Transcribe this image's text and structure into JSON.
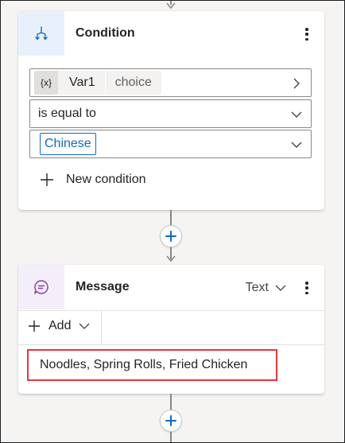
{
  "condition_card": {
    "title": "Condition",
    "icon": "branch-icon",
    "variable": {
      "badge": "{x}",
      "name": "Var1",
      "type": "choice"
    },
    "operator": "is equal to",
    "value": "Chinese",
    "new_condition_label": "New condition"
  },
  "message_card": {
    "title": "Message",
    "icon": "chat-bubble-icon",
    "type_label": "Text",
    "add_label": "Add",
    "message": "Noodles, Spring Rolls, Fried Chicken"
  },
  "colors": {
    "accent": "#0f6cbd",
    "highlight_border": "#e5363d",
    "condition_icon_bg": "#e8f1fb",
    "message_icon_bg": "#f3eefa"
  }
}
